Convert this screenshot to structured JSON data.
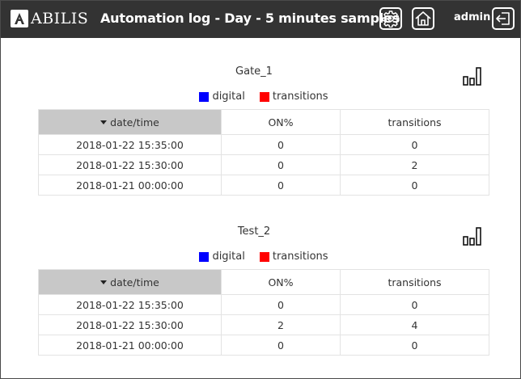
{
  "header": {
    "logo_text": "ABILIS",
    "title": "Automation log - Day - 5 minutes samples",
    "username": "admin",
    "icons": {
      "settings": "gear-icon",
      "home": "home-icon",
      "logout": "logout-icon",
      "chart": "bar-chart-icon"
    }
  },
  "colors": {
    "header_bg": "#333333",
    "digital": "#0000ff",
    "transitions": "#ff0000",
    "sorted_header": "#c8c8c8"
  },
  "legend": {
    "digital": "digital",
    "transitions": "transitions"
  },
  "columns": {
    "datetime": "date/time",
    "on_percent": "ON%",
    "transitions": "transitions"
  },
  "panels": [
    {
      "title": "Gate_1",
      "rows": [
        {
          "datetime": "2018-01-22 15:35:00",
          "on_percent": "0",
          "transitions": "0"
        },
        {
          "datetime": "2018-01-22 15:30:00",
          "on_percent": "0",
          "transitions": "2"
        },
        {
          "datetime": "2018-01-21 00:00:00",
          "on_percent": "0",
          "transitions": "0"
        }
      ]
    },
    {
      "title": "Test_2",
      "rows": [
        {
          "datetime": "2018-01-22 15:35:00",
          "on_percent": "0",
          "transitions": "0"
        },
        {
          "datetime": "2018-01-22 15:30:00",
          "on_percent": "2",
          "transitions": "4"
        },
        {
          "datetime": "2018-01-21 00:00:00",
          "on_percent": "0",
          "transitions": "0"
        }
      ]
    }
  ]
}
